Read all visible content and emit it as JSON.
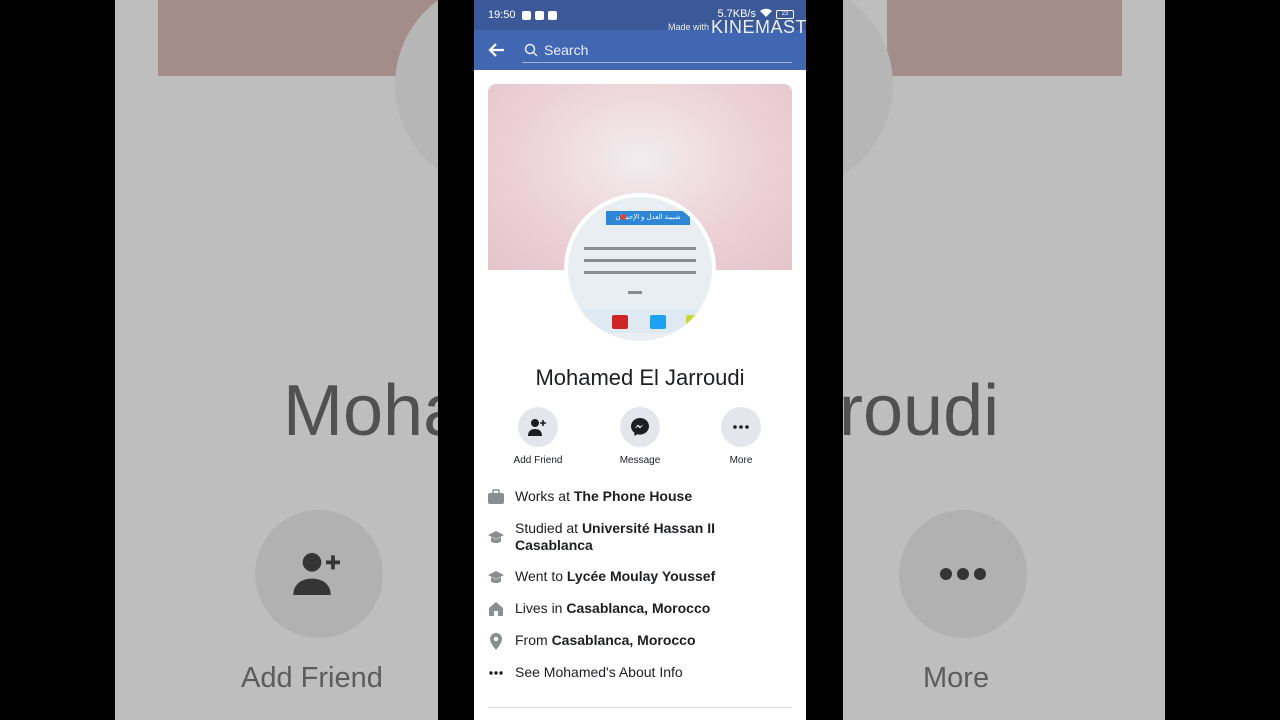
{
  "statusbar": {
    "time": "19:50",
    "network_speed": "5.7KB/s",
    "battery": "23"
  },
  "watermark": {
    "prefix": "Made with",
    "brand": "KINEMASTER"
  },
  "search": {
    "placeholder": "Search"
  },
  "profile": {
    "name": "Mohamed El Jarroudi",
    "avatar_banner_text": "شبيبة العدل و الإحسان"
  },
  "actions": [
    {
      "label": "Add Friend",
      "icon": "add-friend-icon"
    },
    {
      "label": "Message",
      "icon": "messenger-icon"
    },
    {
      "label": "More",
      "icon": "more-icon"
    }
  ],
  "info": [
    {
      "icon": "briefcase-icon",
      "prefix": "Works at ",
      "value": "The Phone House"
    },
    {
      "icon": "graduation-cap-icon",
      "prefix": "Studied at ",
      "value": "Université Hassan II Casablanca"
    },
    {
      "icon": "graduation-cap-icon",
      "prefix": "Went to ",
      "value": "Lycée Moulay Youssef"
    },
    {
      "icon": "home-icon",
      "prefix": "Lives in ",
      "value": "Casablanca, Morocco"
    },
    {
      "icon": "location-pin-icon",
      "prefix": "From ",
      "value": "Casablanca, Morocco"
    },
    {
      "icon": "more-dots-icon",
      "prefix": "See Mohamed's About Info",
      "value": ""
    }
  ],
  "background": {
    "name_left": "Moha",
    "name_right": "roudi",
    "label_left": "Add Friend",
    "label_right": "More"
  },
  "colors": {
    "header_dark": "#3b5998",
    "header": "#4267b2",
    "action_circle": "#e4e6eb",
    "text": "#1c1e21"
  }
}
